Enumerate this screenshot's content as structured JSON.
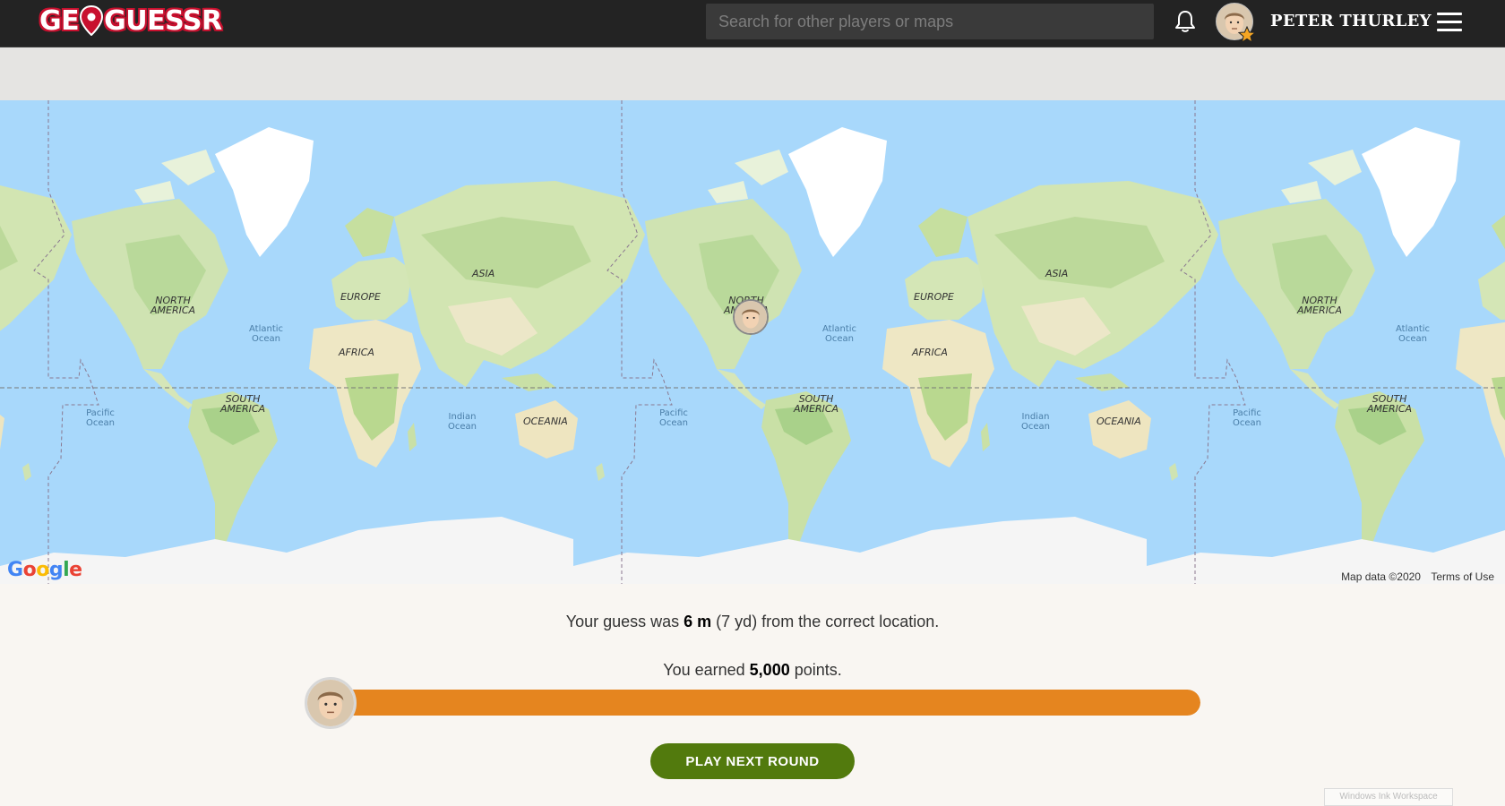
{
  "header": {
    "logo_text_left": "GE",
    "logo_text_right": "GUESSR",
    "search_placeholder": "Search for other players or maps",
    "username": "PETER THURLEY",
    "icons": [
      "bell-icon",
      "star-icon",
      "hamburger-menu-icon"
    ]
  },
  "map": {
    "continent_labels": {
      "north_america": "NORTH\nAMERICA",
      "south_america": "SOUTH\nAMERICA",
      "europe": "EUROPE",
      "asia": "ASIA",
      "africa": "AFRICA",
      "oceania": "OCEANIA"
    },
    "ocean_labels": {
      "atlantic": "Atlantic\nOcean",
      "pacific": "Pacific\nOcean",
      "indian": "Indian\nOcean"
    },
    "google_logo": "Google",
    "map_data": "Map data ©2020",
    "terms": "Terms of Use"
  },
  "result": {
    "guess_prefix": "Your guess was ",
    "distance": "6 m",
    "distance_alt": " (7 yd) from the correct location.",
    "earned_prefix": "You earned ",
    "points": "5,000",
    "earned_suffix": " points.",
    "progress_fraction": 1.0,
    "next_button": "PLAY NEXT ROUND"
  },
  "overlay": {
    "ink_workspace": "Windows Ink Workspace"
  },
  "colors": {
    "topbar": "#232323",
    "ocean": "#a8d8fb",
    "progress": "#e5851f",
    "button": "#527a0d",
    "logo_red": "#c8102e"
  }
}
